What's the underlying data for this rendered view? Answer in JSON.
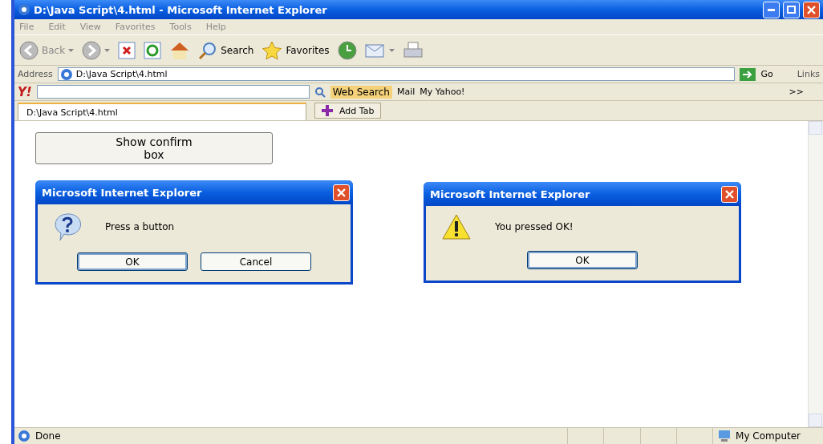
{
  "window": {
    "title": "D:\\Java Script\\4.html - Microsoft Internet Explorer"
  },
  "menu": [
    "File",
    "Edit",
    "View",
    "Favorites",
    "Tools",
    "Help"
  ],
  "toolbar": [
    {
      "kind": "back",
      "label": "Back"
    },
    {
      "kind": "forward"
    },
    {
      "kind": "stop"
    },
    {
      "kind": "refresh"
    },
    {
      "kind": "home"
    },
    {
      "kind": "search",
      "label": "Search"
    },
    {
      "kind": "favorites",
      "label": "Favorites"
    },
    {
      "kind": "history"
    },
    {
      "kind": "mail"
    },
    {
      "kind": "print"
    }
  ],
  "address_bar": {
    "label": "Address",
    "value": "D:\\Java Script\\4.html",
    "go": "Go",
    "links": "Links"
  },
  "yahoo_bar": {
    "logo": "Y!",
    "search_button": "Web Search",
    "mail": "Mail",
    "my_yahoo": "My Yahoo!",
    "more": ">>"
  },
  "tabs": [
    {
      "label": "D:\\Java Script\\4.html",
      "selected": true
    }
  ],
  "add_tab": "Add Tab",
  "page": {
    "button": "Show confirm box"
  },
  "dialogs": [
    {
      "kind": "question",
      "title": "Microsoft Internet Explorer",
      "message": "Press a button",
      "buttons": [
        "OK",
        "Cancel"
      ]
    },
    {
      "kind": "warning",
      "title": "Microsoft Internet Explorer",
      "message": "You pressed OK!",
      "buttons": [
        "OK"
      ]
    }
  ],
  "status_bar": {
    "text": "Done",
    "zone": "My Computer"
  }
}
